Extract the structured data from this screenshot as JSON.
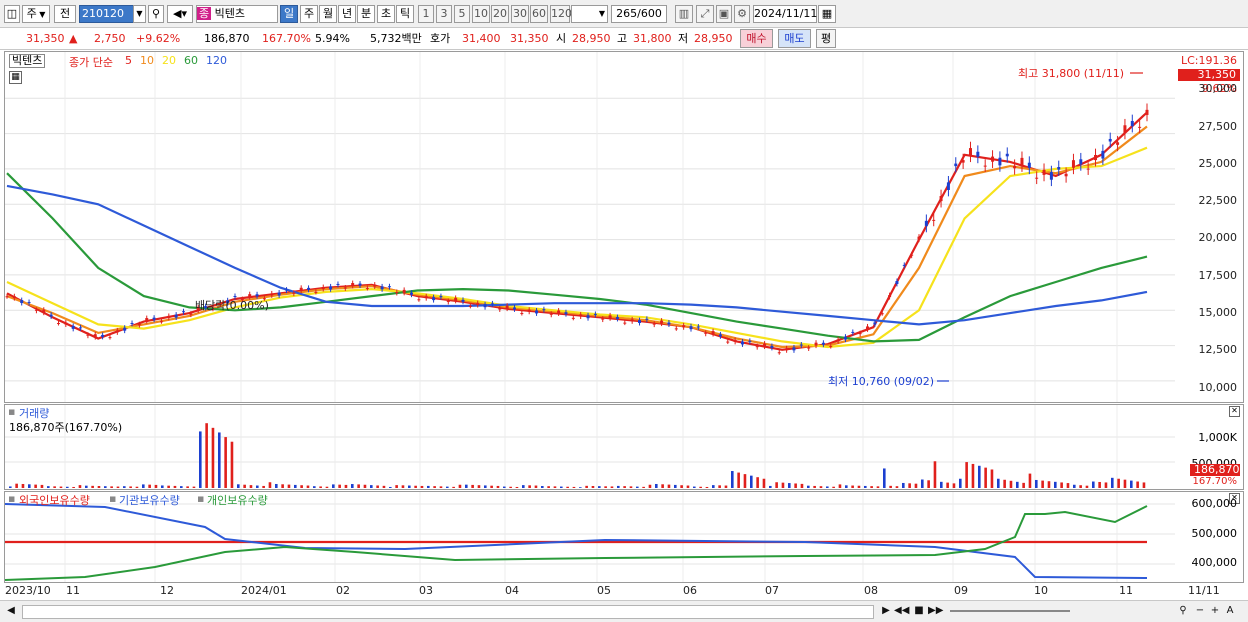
{
  "toolbar": {
    "market": "주",
    "prev_label": "전",
    "code": "210120",
    "name_badge": "종",
    "stock_name": "빅텐츠",
    "periods": [
      "일",
      "주",
      "월",
      "년",
      "분",
      "초",
      "틱"
    ],
    "intervals": [
      "1",
      "3",
      "5",
      "10",
      "20",
      "30",
      "60",
      "120"
    ],
    "count": "265",
    "count_max": "/600",
    "date": "2024/11/11"
  },
  "quote": {
    "price": "31,350",
    "change_arrow": "▲",
    "change": "2,750",
    "change_pct": "+9.62%",
    "volume": "186,870",
    "volume_ratio": "167.70%",
    "turnover": "5.94%",
    "amount": "5,732백만",
    "ask_label": "호가",
    "ask": "31,400",
    "bid": "31,350",
    "open_label": "시",
    "open": "28,950",
    "high_label": "고",
    "high": "31,800",
    "low_label": "저",
    "low": "28,950",
    "buy_button": "매수",
    "sell_button": "매도",
    "avg_button": "평"
  },
  "price_panel": {
    "name_tag": "빅텐츠",
    "ma_prefix": "종가 단순",
    "ma_periods": [
      "5",
      "10",
      "20",
      "60",
      "120"
    ],
    "ma_colors": [
      "#e0201c",
      "#f08a1c",
      "#f6e21c",
      "#2a9a3a",
      "#2e5ad8"
    ],
    "lc_label": "LC:191.36",
    "price_tag": "31,350",
    "price_tag_pct": "9.62%",
    "y_ticks": [
      "30,000",
      "27,500",
      "25,000",
      "22,500",
      "20,000",
      "17,500",
      "15,000",
      "12,500",
      "10,000"
    ],
    "high_annotation": "최고 31,800 (11/11)",
    "low_annotation": "최저 10,760 (09/02)",
    "dividend_annotation": "배당락(0.00%)"
  },
  "volume_panel": {
    "title": "거래량",
    "value": "186,870주(167.70%)",
    "y_ticks": [
      "1,000K",
      "500,000"
    ],
    "tag_value": "186,870",
    "tag_pct": "167.70%"
  },
  "holdings_panel": {
    "series": [
      {
        "name": "외국인보유수량",
        "color": "#e0201c"
      },
      {
        "name": "기관보유수량",
        "color": "#2e5ad8"
      },
      {
        "name": "개인보유수량",
        "color": "#2a9a3a"
      }
    ],
    "y_ticks": [
      "600,000",
      "500,000",
      "400,000"
    ]
  },
  "x_axis": [
    "2023/10",
    "11",
    "12",
    "2024/01",
    "02",
    "03",
    "04",
    "05",
    "06",
    "07",
    "08",
    "09",
    "10",
    "11",
    "11/11"
  ],
  "chart_data": {
    "type": "line",
    "title": "",
    "price_range": [
      9500,
      32000
    ],
    "high": {
      "date": "11/11",
      "value": 31800
    },
    "low": {
      "date": "09/02",
      "value": 10760
    },
    "close_last": 31350,
    "series": [
      {
        "name": "5",
        "values": [
          16200,
          14500,
          13000,
          14200,
          14800,
          15800,
          16200,
          16600,
          16800,
          16000,
          15600,
          15100,
          14800,
          14500,
          14200,
          13800,
          12800,
          12200,
          12600,
          13800,
          20000,
          26000,
          25500,
          24500,
          26000,
          29000
        ]
      },
      {
        "name": "10",
        "values": [
          16000,
          14800,
          13400,
          14000,
          14600,
          15600,
          16100,
          16500,
          16700,
          16100,
          15700,
          15200,
          14900,
          14600,
          14300,
          13800,
          13000,
          12400,
          12500,
          13300,
          18000,
          24500,
          25200,
          24700,
          25500,
          28000
        ]
      },
      {
        "name": "20",
        "values": [
          17000,
          15500,
          14000,
          13700,
          14300,
          15200,
          15900,
          16300,
          16500,
          16200,
          15800,
          15300,
          15000,
          14700,
          14500,
          14000,
          13400,
          12800,
          12400,
          12700,
          15000,
          21500,
          24500,
          25000,
          25200,
          26500
        ]
      },
      {
        "name": "60",
        "values": [
          24700,
          21500,
          18000,
          16000,
          15200,
          15000,
          15200,
          15600,
          16000,
          16400,
          16500,
          16400,
          16100,
          15800,
          15400,
          14800,
          14200,
          13700,
          13200,
          12800,
          12900,
          14500,
          16000,
          17000,
          18000,
          18800
        ]
      },
      {
        "name": "120",
        "values": [
          23800,
          23200,
          22500,
          21000,
          19500,
          18000,
          16600,
          15600,
          15300,
          15300,
          15300,
          15400,
          15500,
          15500,
          15500,
          15400,
          15200,
          14900,
          14600,
          14300,
          14000,
          14300,
          14800,
          15300,
          15700,
          16300
        ]
      }
    ],
    "volume_bars": [
      60,
      40,
      35,
      50,
      45,
      900,
      80,
      60,
      50,
      70,
      40,
      45,
      50,
      40,
      35,
      30,
      45,
      60,
      40,
      300,
      80,
      50,
      40,
      70,
      150,
      360,
      200,
      120,
      90,
      180
    ]
  }
}
